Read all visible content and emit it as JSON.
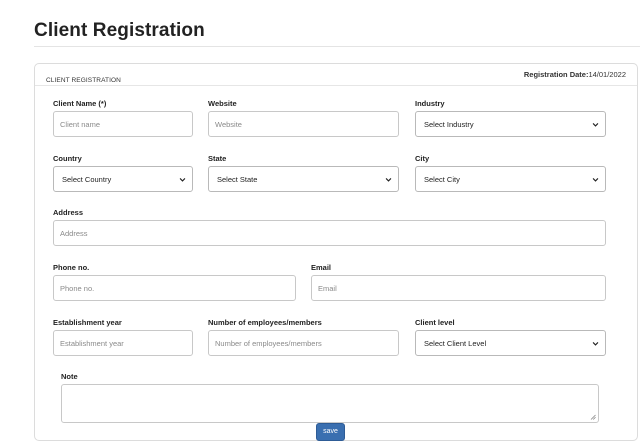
{
  "page": {
    "title": "Client Registration"
  },
  "card": {
    "header_label": "CLIENT REGISTRATION",
    "registration_date_label": "Registration Date:",
    "registration_date_value": "14/01/2022"
  },
  "form": {
    "client_name": {
      "label": "Client Name (*)",
      "placeholder": "Client name"
    },
    "website": {
      "label": "Website",
      "placeholder": "Website"
    },
    "industry": {
      "label": "Industry",
      "selected": "Select Industry"
    },
    "country": {
      "label": "Country",
      "selected": "Select Country"
    },
    "state": {
      "label": "State",
      "selected": "Select State"
    },
    "city": {
      "label": "City",
      "selected": "Select City"
    },
    "address": {
      "label": "Address",
      "placeholder": "Address"
    },
    "phone": {
      "label": "Phone no.",
      "placeholder": "Phone no."
    },
    "email": {
      "label": "Email",
      "placeholder": "Email"
    },
    "establishment_year": {
      "label": "Establishment year",
      "placeholder": "Establishment year"
    },
    "employees": {
      "label": "Number of employees/members",
      "placeholder": "Number of employees/members"
    },
    "client_level": {
      "label": "Client level",
      "selected": "Select Client Level"
    },
    "note": {
      "label": "Note"
    }
  },
  "actions": {
    "save_label": "save"
  },
  "icons": {
    "select_chevron": "chevron-down-icon",
    "resize": "resize-grip-icon"
  }
}
